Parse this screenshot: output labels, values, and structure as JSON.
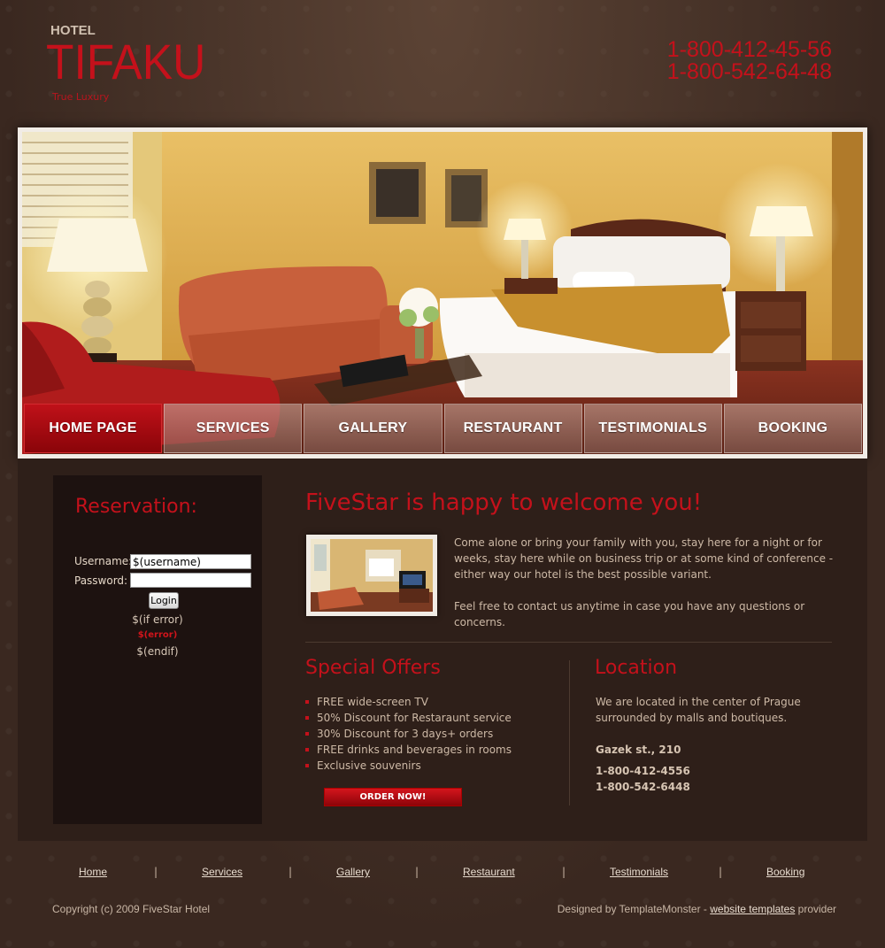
{
  "header": {
    "brand_small": "HOTEL",
    "brand_main": "TIFAKU",
    "tagline": "True Luxury",
    "phones": [
      "1-800-412-45-56",
      "1-800-542-64-48"
    ]
  },
  "nav": {
    "items": [
      "HOME PAGE",
      "SERVICES",
      "GALLERY",
      "RESTAURANT",
      "TESTIMONIALS",
      "BOOKING"
    ],
    "active_index": 0
  },
  "reservation": {
    "title": "Reservation:",
    "username_label": "Username:",
    "username_value": "$(username)",
    "password_label": "Password:",
    "password_value": "",
    "login_label": "Login",
    "if_error": "$(if error)",
    "error": "$(error)",
    "endif": "$(endif)"
  },
  "welcome": {
    "title": "FiveStar is happy to welcome you!",
    "paragraph1": "Come alone or bring your family with you, stay here for a night or for weeks, stay here while on business trip or at some kind of conference - either way our hotel is the best possible variant.",
    "paragraph2": "Feel free to contact us anytime in case you have any questions or concerns."
  },
  "offers": {
    "title": "Special Offers",
    "items": [
      "FREE wide-screen TV",
      "50% Discount for Restaraunt service",
      "30% Discount for 3 days+ orders",
      "FREE drinks and beverages in rooms",
      "Exclusive souvenirs"
    ],
    "button_label": "ORDER NOW!"
  },
  "location": {
    "title": "Location",
    "text": "We are located in the center of Prague surrounded by malls and boutiques.",
    "address": "Gazek st., 210",
    "phone1": "1-800-412-4556",
    "phone2": "1-800-542-6448"
  },
  "footer": {
    "links": [
      "Home",
      "Services",
      "Gallery",
      "Restaurant",
      "Testimonials",
      "Booking"
    ],
    "separator": "|",
    "copyright": "Copyright (c) 2009 FiveStar Hotel",
    "credits_prefix": "Designed by TemplateMonster - ",
    "credits_link": "website templates",
    "credits_suffix": " provider"
  },
  "colors": {
    "accent": "#c4111b",
    "background": "#3a2820",
    "panel": "#2e1f19",
    "sidebar": "#1d1210"
  }
}
